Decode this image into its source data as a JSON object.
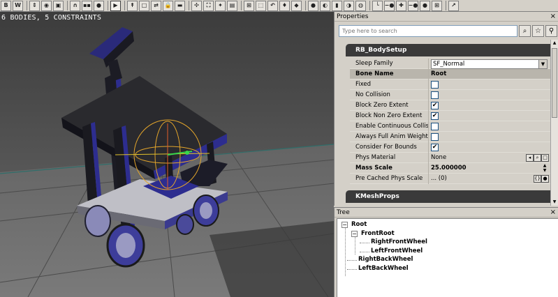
{
  "toolbar": {
    "items": [
      {
        "id": "b",
        "label": "B",
        "icon": "bodies-icon"
      },
      {
        "id": "w",
        "label": "W",
        "icon": "wire-icon"
      },
      {
        "id": "sep1",
        "sep": true
      },
      {
        "id": "t1",
        "label": "⇕",
        "icon": "translate-icon"
      },
      {
        "id": "t2",
        "label": "◉",
        "icon": "rotate-icon"
      },
      {
        "id": "t3",
        "label": "▣",
        "icon": "scale-icon"
      },
      {
        "id": "sep2",
        "sep": true
      },
      {
        "id": "t4",
        "label": "∩",
        "icon": "weld-icon"
      },
      {
        "id": "t5",
        "label": "▪▪",
        "icon": "constraints-icon"
      },
      {
        "id": "t6",
        "label": "●",
        "icon": "record-icon"
      },
      {
        "id": "sep3",
        "sep": true
      },
      {
        "id": "t7",
        "label": "▶",
        "icon": "play-icon",
        "pressed": true
      },
      {
        "id": "sep4",
        "sep": true
      },
      {
        "id": "t8",
        "label": "↟",
        "icon": "arrow-up-icon"
      },
      {
        "id": "t9",
        "label": "□",
        "icon": "box-icon"
      },
      {
        "id": "t10",
        "label": "⇄",
        "icon": "swap-icon"
      },
      {
        "id": "t11",
        "label": "🔒",
        "icon": "lock-icon"
      },
      {
        "id": "t12",
        "label": "▬",
        "icon": "bar-icon"
      },
      {
        "id": "sep5",
        "sep": true
      },
      {
        "id": "t13",
        "label": "✣",
        "icon": "joint-icon"
      },
      {
        "id": "t14",
        "label": "⛶",
        "icon": "frame-icon"
      },
      {
        "id": "t15",
        "label": "✦",
        "icon": "gear-icon"
      },
      {
        "id": "t16",
        "label": "▤",
        "icon": "grid-icon"
      },
      {
        "id": "sep6",
        "sep": true
      },
      {
        "id": "t17",
        "label": "⊞",
        "icon": "joint-type-icon"
      },
      {
        "id": "t18",
        "label": "⬚",
        "icon": "window-icon"
      },
      {
        "id": "t19",
        "label": "↶",
        "icon": "undo-icon"
      },
      {
        "id": "t20",
        "label": "♦",
        "icon": "diamond-icon"
      },
      {
        "id": "t21",
        "label": "◆",
        "icon": "shape-icon"
      },
      {
        "id": "sep7",
        "sep": true
      },
      {
        "id": "t22",
        "label": "●",
        "icon": "sphere-icon"
      },
      {
        "id": "t23",
        "label": "◐",
        "icon": "sphyl-icon"
      },
      {
        "id": "t24",
        "label": "▮",
        "icon": "box-primitive-icon"
      },
      {
        "id": "t25",
        "label": "◑",
        "icon": "convex-icon"
      },
      {
        "id": "t26",
        "label": "◍",
        "icon": "cylinder-icon"
      },
      {
        "id": "sep8",
        "sep": true
      },
      {
        "id": "t27",
        "label": "└",
        "icon": "corner-icon"
      },
      {
        "id": "t28",
        "label": "−●",
        "icon": "weld-bodies-icon"
      },
      {
        "id": "t29",
        "label": "✚",
        "icon": "add-icon"
      },
      {
        "id": "t30",
        "label": "−●",
        "icon": "unweld-icon"
      },
      {
        "id": "t31",
        "label": "●",
        "icon": "dot-icon"
      },
      {
        "id": "t32",
        "label": "⊞",
        "icon": "grid-icon-2"
      },
      {
        "id": "sep9",
        "sep": true
      },
      {
        "id": "t33",
        "label": "↗",
        "icon": "arrow-icon"
      }
    ]
  },
  "viewport": {
    "stats": "6 BODIES, 5 CONSTRAINTS"
  },
  "properties": {
    "title": "Properties",
    "close": "×",
    "search_placeholder": "Type here to search",
    "categories": [
      {
        "title": "RB_BodySetup"
      },
      {
        "title": "KMeshProps"
      }
    ],
    "rows": [
      {
        "name": "Sleep Family",
        "kind": "combo",
        "value": "SF_Normal"
      },
      {
        "name": "Bone Name",
        "kind": "text",
        "value": "Root",
        "header": true
      },
      {
        "name": "Fixed",
        "kind": "check",
        "checked": false
      },
      {
        "name": "No Collision",
        "kind": "check",
        "checked": false
      },
      {
        "name": "Block Zero Extent",
        "kind": "check",
        "checked": true
      },
      {
        "name": "Block Non Zero Extent",
        "kind": "check",
        "checked": true
      },
      {
        "name": "Enable Continuous Collision Detection",
        "kind": "check",
        "checked": false
      },
      {
        "name": "Always Full Anim Weight",
        "kind": "check",
        "checked": false
      },
      {
        "name": "Consider For Bounds",
        "kind": "check",
        "checked": true
      },
      {
        "name": "Phys Material",
        "kind": "text",
        "value": "None"
      },
      {
        "name": "Mass Scale",
        "kind": "text",
        "value": "25.000000",
        "bold": true
      },
      {
        "name": "Pre Cached Phys Scale",
        "kind": "text",
        "value": "... (0)"
      }
    ]
  },
  "tree": {
    "title": "Tree",
    "close": "×",
    "nodes": [
      {
        "label": "Root",
        "depth": 0,
        "expand": "⊟"
      },
      {
        "label": "FrontRoot",
        "depth": 1,
        "expand": "⊟"
      },
      {
        "label": "RightFrontWheel",
        "depth": 2
      },
      {
        "label": "LeftFrontWheel",
        "depth": 2
      },
      {
        "label": "RightBackWheel",
        "depth": 1
      },
      {
        "label": "LeftBackWheel",
        "depth": 1
      }
    ]
  },
  "colors": {
    "viewport_bg": "#4a4a4a",
    "category_header": "#3a3a3a",
    "mesh_blue": "#2d2d8f",
    "mesh_dark": "#1e1e26",
    "gizmo_orange": "#e3a52b",
    "gizmo_green": "#39d64a"
  }
}
